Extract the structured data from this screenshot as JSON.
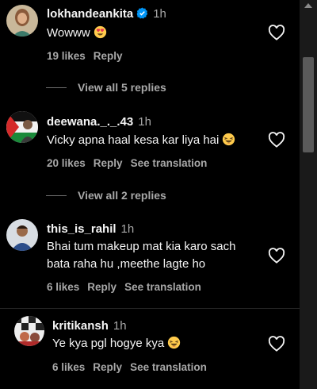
{
  "comments": [
    {
      "username": "lokhandeankita",
      "verified": true,
      "time": "1h",
      "text": "Wowww",
      "emoji": "heart-eyes",
      "likes": "19 likes",
      "reply": "Reply",
      "view_replies": "View all 5 replies"
    },
    {
      "username": "deewana._._.43",
      "time": "1h",
      "text": "Vicky apna haal kesa kar liya hai",
      "emoji": "laughing",
      "likes": "20 likes",
      "reply": "Reply",
      "see_translation": "See translation",
      "view_replies": "View all 2 replies"
    },
    {
      "username": "this_is_rahil",
      "time": "1h",
      "text_line1": "Bhai tum makeup mat kia karo sach",
      "text_line2": "bata raha hu ,meethe lagte ho",
      "likes": "6 likes",
      "reply": "Reply",
      "see_translation": "See translation"
    },
    {
      "username": "kritikansh",
      "time": "1h",
      "text": "Ye kya pgl hogye kya",
      "emoji": "laughing",
      "likes": "6 likes",
      "reply": "Reply",
      "see_translation": "See translation"
    }
  ],
  "colors": {
    "background": "#000000",
    "text": "#f5f5f5",
    "secondary_text": "#a8a8a8",
    "verified_badge": "#0095f6"
  }
}
